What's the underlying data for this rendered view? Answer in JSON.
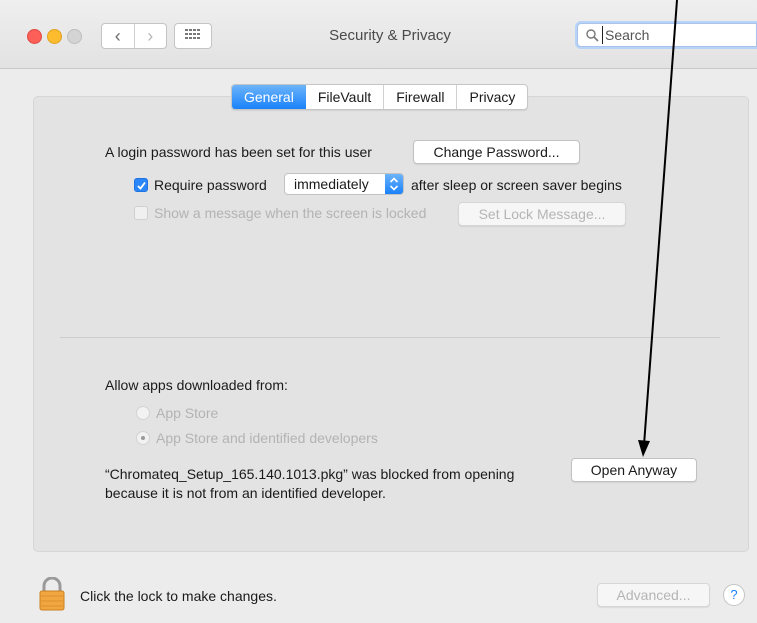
{
  "window": {
    "title": "Security & Privacy"
  },
  "search": {
    "placeholder": "Search"
  },
  "tabs": [
    {
      "label": "General",
      "active": true
    },
    {
      "label": "FileVault",
      "active": false
    },
    {
      "label": "Firewall",
      "active": false
    },
    {
      "label": "Privacy",
      "active": false
    }
  ],
  "general": {
    "login_text": "A login password has been set for this user",
    "change_password_label": "Change Password...",
    "require_password": {
      "checked": true,
      "label": "Require password",
      "select_value": "immediately",
      "after_text": "after sleep or screen saver begins"
    },
    "show_message": {
      "checked": false,
      "label": "Show a message when the screen is locked",
      "button_label": "Set Lock Message..."
    },
    "allow_apps_label": "Allow apps downloaded from:",
    "options": [
      {
        "label": "App Store",
        "selected": false
      },
      {
        "label": "App Store and identified developers",
        "selected": true
      }
    ],
    "blocked_line1": "“Chromateq_Setup_165.140.1013.pkg” was blocked from opening",
    "blocked_line2": "because it is not from an identified developer.",
    "open_anyway_label": "Open Anyway"
  },
  "footer": {
    "lock_text": "Click the lock to make changes.",
    "advanced_label": "Advanced...",
    "help_label": "?"
  },
  "colors": {
    "accent": "#1a82fb",
    "close": "#fc5f57",
    "minimize": "#fdbc2e"
  }
}
